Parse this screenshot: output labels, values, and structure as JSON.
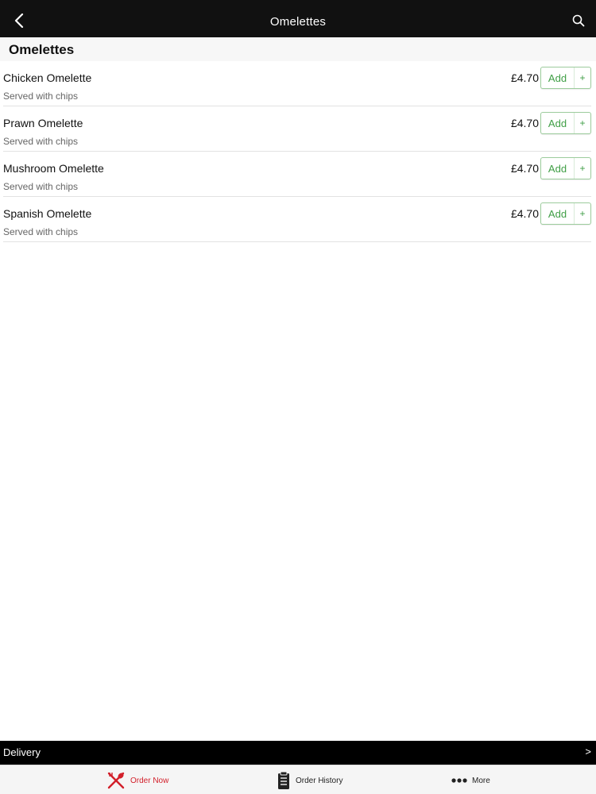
{
  "header": {
    "title": "Omelettes",
    "back_icon": "chevron-left-icon",
    "search_icon": "search-icon"
  },
  "section": {
    "title": "Omelettes"
  },
  "items": [
    {
      "name": "Chicken Omelette",
      "description": "Served with chips",
      "price": "£4.70",
      "add_label": "Add",
      "add_plus": "+"
    },
    {
      "name": "Prawn Omelette",
      "description": "Served with chips",
      "price": "£4.70",
      "add_label": "Add",
      "add_plus": "+"
    },
    {
      "name": "Mushroom Omelette",
      "description": "Served with chips",
      "price": "£4.70",
      "add_label": "Add",
      "add_plus": "+"
    },
    {
      "name": "Spanish Omelette",
      "description": "Served with chips",
      "price": "£4.70",
      "add_label": "Add",
      "add_plus": "+"
    }
  ],
  "delivery": {
    "label": "Delivery",
    "arrow": ">"
  },
  "tabs": [
    {
      "label": "Order Now",
      "icon": "fork-knife-icon",
      "active": true
    },
    {
      "label": "Order History",
      "icon": "clipboard-icon",
      "active": false
    },
    {
      "label": "More",
      "icon": "more-dots-icon",
      "active": false
    }
  ],
  "colors": {
    "nav_background": "#111111",
    "accent_green": "#3f9e45",
    "active_tab_red": "#d21f2a"
  }
}
